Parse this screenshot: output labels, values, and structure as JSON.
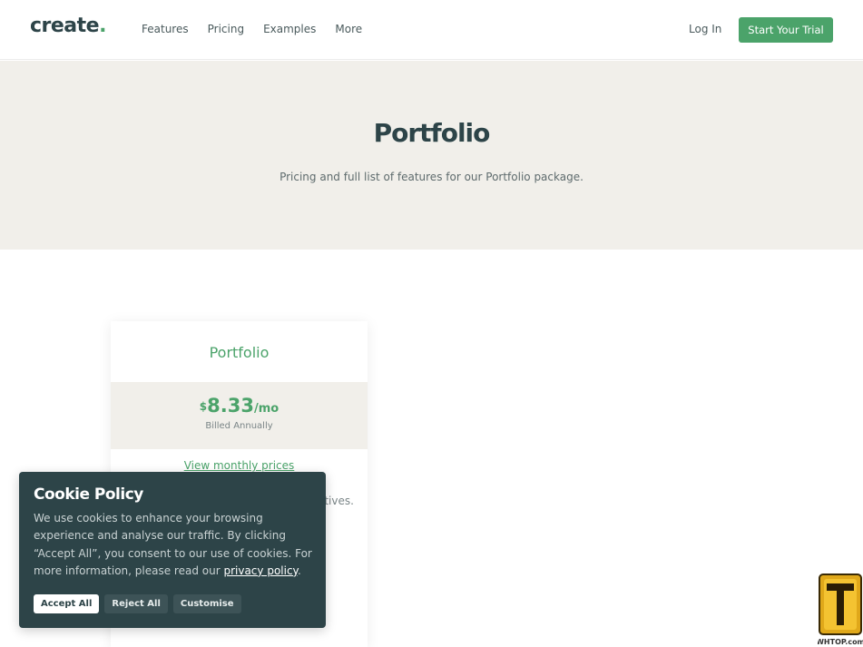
{
  "header": {
    "logo_text": "create",
    "logo_dot": ".",
    "nav": [
      "Features",
      "Pricing",
      "Examples",
      "More"
    ],
    "login_label": "Log In",
    "trial_label": "Start Your Trial"
  },
  "hero": {
    "title": "Portfolio",
    "subtitle": "Pricing and full list of features for our Portfolio package."
  },
  "card": {
    "title": "Portfolio",
    "currency": "$",
    "amount": "8.33",
    "period": "/mo",
    "billing": "Billed Annually",
    "monthly_link": "View monthly prices",
    "desc_tail": "atives."
  },
  "cookie": {
    "title": "Cookie Policy",
    "text": "We use cookies to enhance your browsing experience and analyse our traffic. By clicking “Accept All”, you consent to our use of cookies. For more information, please read our ",
    "link": "privacy policy",
    "text_end": ".",
    "accept": "Accept All",
    "reject": "Reject All",
    "customise": "Customise"
  },
  "watermark": {
    "text": "WHTOP.com"
  },
  "colors": {
    "brand_green": "#4ba36a",
    "dark_teal": "#2d4448",
    "hero_bg": "#f1efea"
  }
}
